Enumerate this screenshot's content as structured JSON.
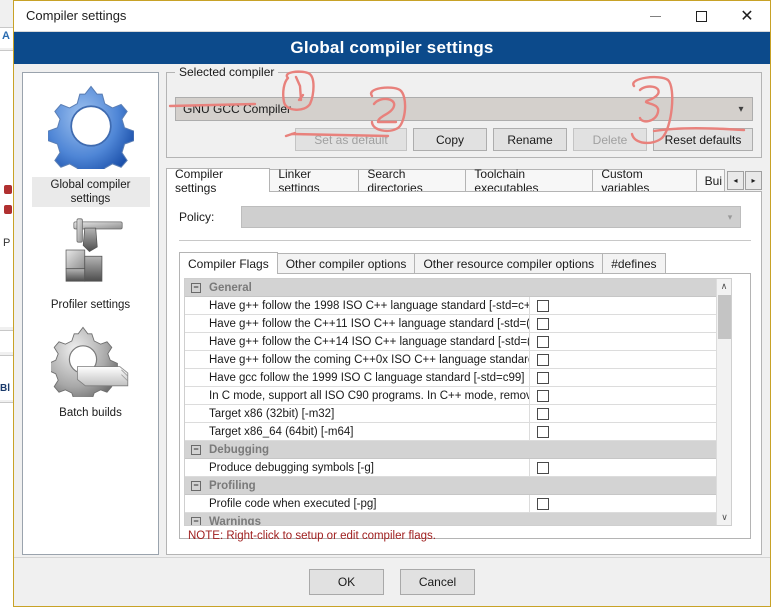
{
  "window": {
    "title": "Compiler settings",
    "banner": "Global compiler settings",
    "controls": {
      "minimize": "minimize-button",
      "maximize": "maximize-button",
      "close": "close-button"
    }
  },
  "colors": {
    "banner_bg": "#0c4a8b",
    "window_border": "#c8a227",
    "note_text": "#a02020",
    "annotation": "#e8817c",
    "group_header_bg": "#d3d3d3"
  },
  "sidebar": {
    "items": [
      {
        "label": "Global compiler settings",
        "icon": "blue-gear-icon",
        "selected": true
      },
      {
        "label": "Profiler settings",
        "icon": "caliper-blocks-icon",
        "selected": false
      },
      {
        "label": "Batch builds",
        "icon": "gear-stack-icon",
        "selected": false
      }
    ]
  },
  "selected_compiler": {
    "group_title": "Selected compiler",
    "dropdown_value": "GNU GCC Compiler",
    "buttons": [
      {
        "label": "Set as default",
        "enabled": false
      },
      {
        "label": "Copy",
        "enabled": true
      },
      {
        "label": "Rename",
        "enabled": true
      },
      {
        "label": "Delete",
        "enabled": false
      },
      {
        "label": "Reset defaults",
        "enabled": true
      }
    ]
  },
  "outer_tabs": {
    "items": [
      {
        "label": "Compiler settings",
        "active": true
      },
      {
        "label": "Linker settings",
        "active": false
      },
      {
        "label": "Search directories",
        "active": false
      },
      {
        "label": "Toolchain executables",
        "active": false
      },
      {
        "label": "Custom variables",
        "active": false
      },
      {
        "label": "Bui",
        "active": false
      }
    ],
    "scroll_left": "◂",
    "scroll_right": "▸"
  },
  "policy": {
    "label": "Policy:",
    "value": ""
  },
  "inner_tabs": {
    "items": [
      {
        "label": "Compiler Flags",
        "active": true
      },
      {
        "label": "Other compiler options",
        "active": false
      },
      {
        "label": "Other resource compiler options",
        "active": false
      },
      {
        "label": "#defines",
        "active": false
      }
    ]
  },
  "flags": {
    "rows": [
      {
        "type": "group",
        "label": "General",
        "expander": "−"
      },
      {
        "type": "flag",
        "label": "Have g++ follow the 1998 ISO C++ language standard  [-std=c+",
        "checked": false
      },
      {
        "type": "flag",
        "label": "Have g++ follow the C++11 ISO C++ language standard  [-std=(",
        "checked": false
      },
      {
        "type": "flag",
        "label": "Have g++ follow the C++14 ISO C++ language standard  [-std=(",
        "checked": false
      },
      {
        "type": "flag",
        "label": "Have g++ follow the coming C++0x ISO C++ language standard",
        "checked": false
      },
      {
        "type": "flag",
        "label": "Have gcc follow the 1999 ISO C language standard  [-std=c99]",
        "checked": false
      },
      {
        "type": "flag",
        "label": "In C mode, support all ISO C90 programs. In C++ mode, remove",
        "checked": false
      },
      {
        "type": "flag",
        "label": "Target x86 (32bit)  [-m32]",
        "checked": false
      },
      {
        "type": "flag",
        "label": "Target x86_64 (64bit)  [-m64]",
        "checked": false
      },
      {
        "type": "group",
        "label": "Debugging",
        "expander": "−"
      },
      {
        "type": "flag",
        "label": "Produce debugging symbols  [-g]",
        "checked": false
      },
      {
        "type": "group",
        "label": "Profiling",
        "expander": "−"
      },
      {
        "type": "flag",
        "label": "Profile code when executed  [-pg]",
        "checked": false
      },
      {
        "type": "group",
        "label": "Warnings",
        "expander": "−"
      }
    ],
    "scrollbar": {
      "up_arrow": "∧",
      "down_arrow": "∨"
    }
  },
  "note": "NOTE: Right-click to setup or edit compiler flags.",
  "bottom_buttons": [
    {
      "label": "OK"
    },
    {
      "label": "Cancel"
    }
  ],
  "annotations": [
    {
      "label": "1",
      "target": "selected-compiler-dropdown"
    },
    {
      "label": "2",
      "target": "set-as-default-button"
    },
    {
      "label": "3",
      "target": "reset-defaults-button"
    }
  ],
  "background_app": {
    "letter": "A",
    "bl": "Bl",
    "p": "P"
  }
}
